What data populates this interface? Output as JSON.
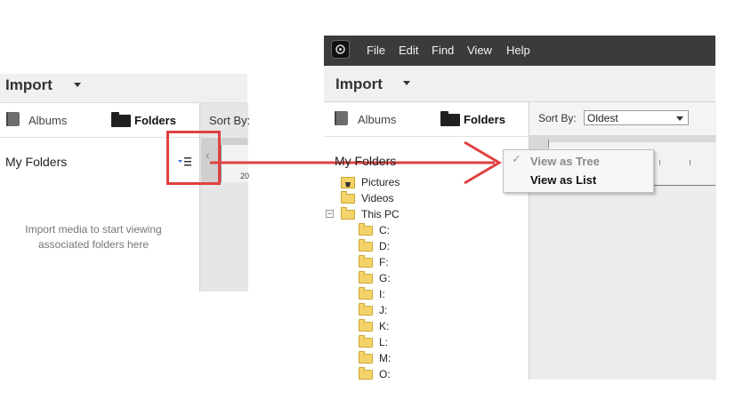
{
  "left_panel": {
    "title": "Import",
    "tabs": [
      {
        "label": "Albums",
        "icon": "album-book-icon",
        "active": false
      },
      {
        "label": "Folders",
        "icon": "folder-icon",
        "active": true
      }
    ],
    "sort_label": "Sort By:",
    "section_title": "My Folders",
    "view_toggle_icon": "view-options-icon",
    "empty_message_line1": "Import media to start viewing",
    "empty_message_line2": "associated folders here",
    "ruler_label": "20"
  },
  "right_panel": {
    "menubar": [
      "File",
      "Edit",
      "Find",
      "View",
      "Help"
    ],
    "title": "Import",
    "tabs": [
      {
        "label": "Albums",
        "icon": "album-book-icon",
        "active": false
      },
      {
        "label": "Folders",
        "icon": "folder-icon",
        "active": true
      }
    ],
    "sort_label": "Sort By:",
    "sort_value": "Oldest",
    "section_title": "My Folders",
    "tree": {
      "top_items": [
        "Pictures",
        "Videos"
      ],
      "this_pc": "This PC",
      "this_pc_expander": "−",
      "drives": [
        "C:",
        "D:",
        "F:",
        "G:",
        "I:",
        "J:",
        "K:",
        "L:",
        "M:",
        "O:"
      ]
    },
    "context_menu": [
      {
        "label": "View as Tree",
        "checked": true,
        "check_mark": "✓"
      },
      {
        "label": "View as List",
        "checked": false
      }
    ]
  },
  "colors": {
    "highlight": "#e04040",
    "menubar_bg": "#3b3b3b",
    "folder_yellow": "#f4d46a"
  }
}
